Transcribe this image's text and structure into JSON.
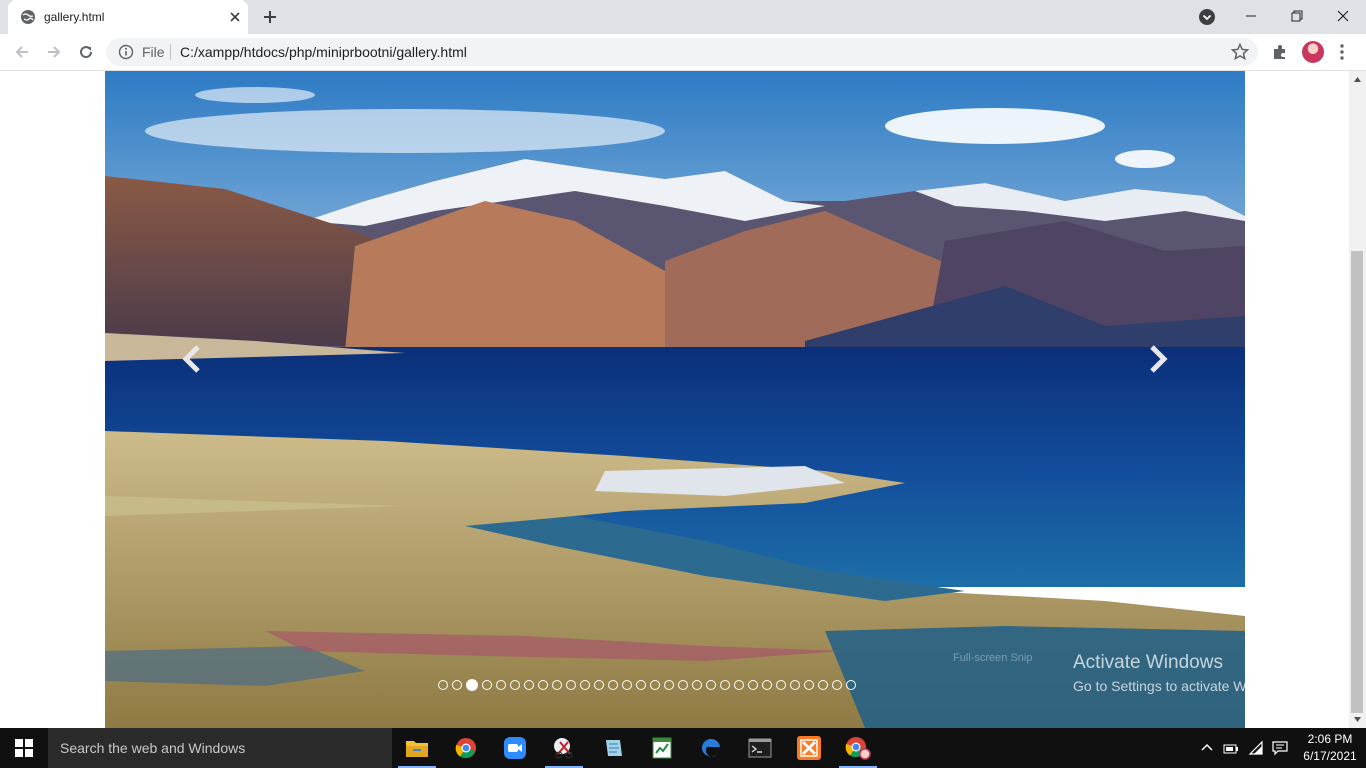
{
  "browser": {
    "tab": {
      "title": "gallery.html"
    },
    "address": {
      "scheme_label": "File",
      "url": "C:/xampp/htdocs/php/miniprbootni/gallery.html"
    }
  },
  "carousel": {
    "image_description": "Mountain lake landscape",
    "slide_count": 30,
    "active_index": 2,
    "prev_icon": "chevron-left-icon",
    "next_icon": "chevron-right-icon"
  },
  "overlay": {
    "activate_title": "Activate Windows",
    "activate_sub": "Go to Settings to activate Windows.",
    "snip_label": "Full-screen Snip"
  },
  "taskbar": {
    "search_placeholder": "Search the web and Windows",
    "apps": [
      "file-explorer-icon",
      "chrome-icon",
      "zoom-icon",
      "snipping-tool-icon",
      "notepad-icon",
      "spreadsheet-icon",
      "edge-icon",
      "terminal-icon",
      "xampp-icon",
      "chrome-profile-icon"
    ],
    "time": "2:06 PM",
    "date": "6/17/2021"
  },
  "colors": {
    "accent": "#1a73e8",
    "taskbar": "#101010",
    "tabstrip": "#dee1e6"
  }
}
